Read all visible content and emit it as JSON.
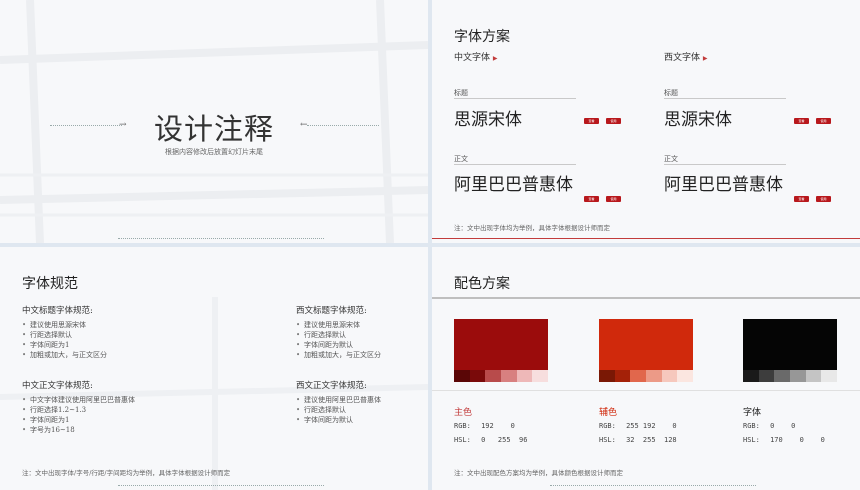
{
  "slide1": {
    "title": "设计注释",
    "subtitle": "根据内容修改后放置幻灯片末尾"
  },
  "slide2": {
    "title": "字体方案",
    "cn_header": "中文字体",
    "west_header": "西文字体",
    "title_label": "标题",
    "body_label": "正文",
    "cn_title_font": "思源宋体",
    "cn_body_font": "阿里巴巴普惠体",
    "west_title_font": "思源宋体",
    "west_body_font": "阿里巴巴普惠体",
    "btn_a": "查看",
    "btn_b": "使用",
    "note": "注：文中出现字体均为举例，具体字体根据设计师而定"
  },
  "slide3": {
    "title": "字体规范",
    "groups": [
      {
        "heading": "中文标题字体规范:",
        "items": [
          "建议使用思源宋体",
          "行距选择默认",
          "字体间距为1",
          "加粗或加大，与正文区分"
        ]
      },
      {
        "heading": "西文标题字体规范:",
        "items": [
          "建议使用思源宋体",
          "行距选择默认",
          "字体间距为默认",
          "加粗或加大，与正文区分"
        ]
      },
      {
        "heading": "中文正文字体规范:",
        "items": [
          "中文字体建议使用阿里巴巴普惠体",
          "行距选择1.2~1.3",
          "字体间距为1",
          "字号为16~18"
        ]
      },
      {
        "heading": "西文正文字体规范:",
        "items": [
          "建议使用阿里巴巴普惠体",
          "行距选择默认",
          "字体间距为默认"
        ]
      }
    ],
    "note": "注：文中出现字体/字号/行距/字间距均为举例，具体字体根据设计师而定"
  },
  "slide4": {
    "title": "配色方案",
    "colors": [
      {
        "name": "主色",
        "hex": "#9b0c0c",
        "rgb_label": "RGB:",
        "rgb": "192    0",
        "hsl_label": "HSL:",
        "hsl": "0   255  96",
        "name_color": "#c23b3b",
        "tints": [
          "#5a0606",
          "#7a0a0a",
          "#b84b4b",
          "#d88080",
          "#eeb8b8",
          "#f7dede"
        ]
      },
      {
        "name": "辅色",
        "hex": "#d0290c",
        "rgb_label": "RGB:",
        "rgb": "255 192    0",
        "hsl_label": "HSL:",
        "hsl": "32  255  128",
        "name_color": "#d0290c",
        "tints": [
          "#7a1805",
          "#a42108",
          "#e1674c",
          "#ec9a87",
          "#f6c8bd",
          "#fbe6e0"
        ]
      },
      {
        "name": "字体",
        "hex": "#050505",
        "rgb_label": "RGB:",
        "rgb": "0    0",
        "hsl_label": "HSL:",
        "hsl": "170    0    0",
        "name_color": "#222222",
        "tints": [
          "#1a1a1a",
          "#3d3d3d",
          "#6a6a6a",
          "#979797",
          "#c4c4c4",
          "#e8e8e8"
        ]
      }
    ],
    "note": "注：文中出现配色方案均为举例，具体颜色根据设计师而定"
  }
}
